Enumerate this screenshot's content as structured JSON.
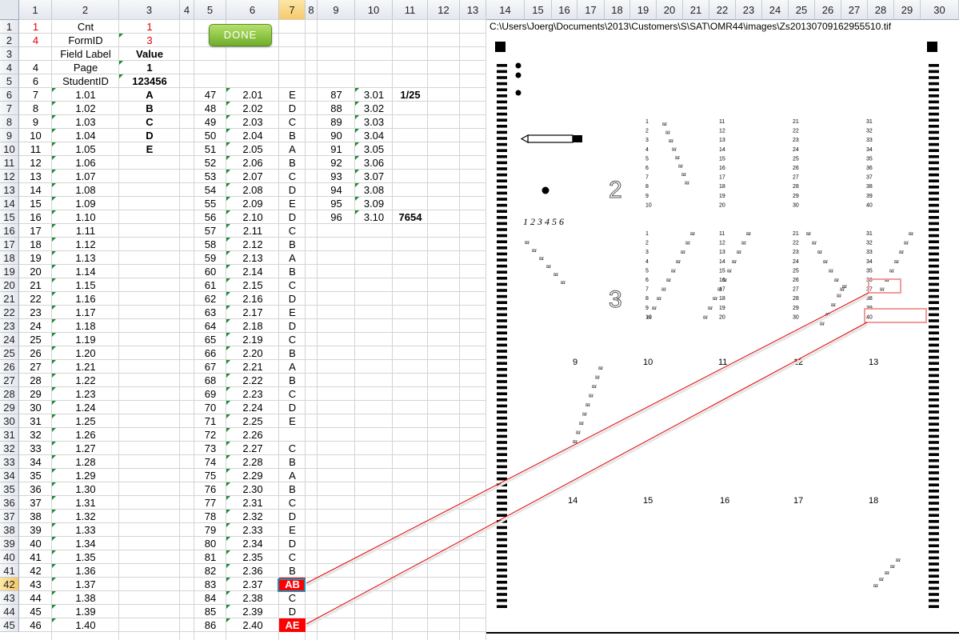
{
  "colors": {
    "red": "#e00000",
    "fill_red": "#ff0000",
    "done_green": "#7fbb35",
    "active_border": "#1e8fb7"
  },
  "columns": [
    "1",
    "2",
    "3",
    "4",
    "5",
    "6",
    "7",
    "8",
    "9",
    "10",
    "11",
    "12",
    "13",
    "14",
    "15",
    "16",
    "17",
    "18",
    "19",
    "20",
    "21",
    "22",
    "23",
    "24",
    "25",
    "26",
    "27",
    "28",
    "29",
    "30"
  ],
  "rows": [
    "1",
    "2",
    "3",
    "4",
    "5",
    "6",
    "7",
    "8",
    "9",
    "10",
    "11",
    "12",
    "13",
    "14",
    "15",
    "16",
    "17",
    "18",
    "19",
    "20",
    "21",
    "22",
    "23",
    "24",
    "25",
    "26",
    "27",
    "28",
    "29",
    "30",
    "31",
    "32",
    "33",
    "34",
    "35",
    "36",
    "37",
    "38",
    "39",
    "40",
    "41",
    "42",
    "43",
    "44",
    "45"
  ],
  "header": {
    "cnt_label": "Cnt",
    "cnt_num": "1",
    "cnt_value": "1",
    "formid_label": "FormID",
    "formid_num": "4",
    "formid_value": "3",
    "field_label": "Field Label",
    "value_label": "Value",
    "page_num": "4",
    "page_label": "Page",
    "page_value": "1",
    "studentid_num": "6",
    "studentid_label": "StudentID",
    "studentid_value": "123456",
    "done_label": "DONE"
  },
  "block1": [
    {
      "n": "7",
      "f": "1.01",
      "v": "A"
    },
    {
      "n": "8",
      "f": "1.02",
      "v": "B"
    },
    {
      "n": "9",
      "f": "1.03",
      "v": "C"
    },
    {
      "n": "10",
      "f": "1.04",
      "v": "D"
    },
    {
      "n": "11",
      "f": "1.05",
      "v": "E"
    },
    {
      "n": "12",
      "f": "1.06",
      "v": ""
    },
    {
      "n": "13",
      "f": "1.07",
      "v": ""
    },
    {
      "n": "14",
      "f": "1.08",
      "v": ""
    },
    {
      "n": "15",
      "f": "1.09",
      "v": ""
    },
    {
      "n": "16",
      "f": "1.10",
      "v": ""
    },
    {
      "n": "17",
      "f": "1.11",
      "v": ""
    },
    {
      "n": "18",
      "f": "1.12",
      "v": ""
    },
    {
      "n": "19",
      "f": "1.13",
      "v": ""
    },
    {
      "n": "20",
      "f": "1.14",
      "v": ""
    },
    {
      "n": "21",
      "f": "1.15",
      "v": ""
    },
    {
      "n": "22",
      "f": "1.16",
      "v": ""
    },
    {
      "n": "23",
      "f": "1.17",
      "v": ""
    },
    {
      "n": "24",
      "f": "1.18",
      "v": ""
    },
    {
      "n": "25",
      "f": "1.19",
      "v": ""
    },
    {
      "n": "26",
      "f": "1.20",
      "v": ""
    },
    {
      "n": "27",
      "f": "1.21",
      "v": ""
    },
    {
      "n": "28",
      "f": "1.22",
      "v": ""
    },
    {
      "n": "29",
      "f": "1.23",
      "v": ""
    },
    {
      "n": "30",
      "f": "1.24",
      "v": ""
    },
    {
      "n": "31",
      "f": "1.25",
      "v": ""
    },
    {
      "n": "32",
      "f": "1.26",
      "v": ""
    },
    {
      "n": "33",
      "f": "1.27",
      "v": ""
    },
    {
      "n": "34",
      "f": "1.28",
      "v": ""
    },
    {
      "n": "35",
      "f": "1.29",
      "v": ""
    },
    {
      "n": "36",
      "f": "1.30",
      "v": ""
    },
    {
      "n": "37",
      "f": "1.31",
      "v": ""
    },
    {
      "n": "38",
      "f": "1.32",
      "v": ""
    },
    {
      "n": "39",
      "f": "1.33",
      "v": ""
    },
    {
      "n": "40",
      "f": "1.34",
      "v": ""
    },
    {
      "n": "41",
      "f": "1.35",
      "v": ""
    },
    {
      "n": "42",
      "f": "1.36",
      "v": ""
    },
    {
      "n": "43",
      "f": "1.37",
      "v": ""
    },
    {
      "n": "44",
      "f": "1.38",
      "v": ""
    },
    {
      "n": "45",
      "f": "1.39",
      "v": ""
    },
    {
      "n": "46",
      "f": "1.40",
      "v": ""
    }
  ],
  "block2": [
    {
      "n": "47",
      "f": "2.01",
      "v": "E"
    },
    {
      "n": "48",
      "f": "2.02",
      "v": "D"
    },
    {
      "n": "49",
      "f": "2.03",
      "v": "C"
    },
    {
      "n": "50",
      "f": "2.04",
      "v": "B"
    },
    {
      "n": "51",
      "f": "2.05",
      "v": "A"
    },
    {
      "n": "52",
      "f": "2.06",
      "v": "B"
    },
    {
      "n": "53",
      "f": "2.07",
      "v": "C"
    },
    {
      "n": "54",
      "f": "2.08",
      "v": "D"
    },
    {
      "n": "55",
      "f": "2.09",
      "v": "E"
    },
    {
      "n": "56",
      "f": "2.10",
      "v": "D"
    },
    {
      "n": "57",
      "f": "2.11",
      "v": "C"
    },
    {
      "n": "58",
      "f": "2.12",
      "v": "B"
    },
    {
      "n": "59",
      "f": "2.13",
      "v": "A"
    },
    {
      "n": "60",
      "f": "2.14",
      "v": "B"
    },
    {
      "n": "61",
      "f": "2.15",
      "v": "C"
    },
    {
      "n": "62",
      "f": "2.16",
      "v": "D"
    },
    {
      "n": "63",
      "f": "2.17",
      "v": "E"
    },
    {
      "n": "64",
      "f": "2.18",
      "v": "D"
    },
    {
      "n": "65",
      "f": "2.19",
      "v": "C"
    },
    {
      "n": "66",
      "f": "2.20",
      "v": "B"
    },
    {
      "n": "67",
      "f": "2.21",
      "v": "A"
    },
    {
      "n": "68",
      "f": "2.22",
      "v": "B"
    },
    {
      "n": "69",
      "f": "2.23",
      "v": "C"
    },
    {
      "n": "70",
      "f": "2.24",
      "v": "D"
    },
    {
      "n": "71",
      "f": "2.25",
      "v": "E"
    },
    {
      "n": "72",
      "f": "2.26",
      "v": ""
    },
    {
      "n": "73",
      "f": "2.27",
      "v": "C"
    },
    {
      "n": "74",
      "f": "2.28",
      "v": "B"
    },
    {
      "n": "75",
      "f": "2.29",
      "v": "A"
    },
    {
      "n": "76",
      "f": "2.30",
      "v": "B"
    },
    {
      "n": "77",
      "f": "2.31",
      "v": "C"
    },
    {
      "n": "78",
      "f": "2.32",
      "v": "D"
    },
    {
      "n": "79",
      "f": "2.33",
      "v": "E"
    },
    {
      "n": "80",
      "f": "2.34",
      "v": "D"
    },
    {
      "n": "81",
      "f": "2.35",
      "v": "C"
    },
    {
      "n": "82",
      "f": "2.36",
      "v": "B"
    },
    {
      "n": "83",
      "f": "2.37",
      "v": "AB"
    },
    {
      "n": "84",
      "f": "2.38",
      "v": "C"
    },
    {
      "n": "85",
      "f": "2.39",
      "v": "D"
    },
    {
      "n": "86",
      "f": "2.40",
      "v": "AE"
    }
  ],
  "block3": [
    {
      "n": "87",
      "f": "3.01",
      "x": "1/25"
    },
    {
      "n": "88",
      "f": "3.02",
      "x": ""
    },
    {
      "n": "89",
      "f": "3.03",
      "x": ""
    },
    {
      "n": "90",
      "f": "3.04",
      "x": ""
    },
    {
      "n": "91",
      "f": "3.05",
      "x": ""
    },
    {
      "n": "92",
      "f": "3.06",
      "x": ""
    },
    {
      "n": "93",
      "f": "3.07",
      "x": ""
    },
    {
      "n": "94",
      "f": "3.08",
      "x": ""
    },
    {
      "n": "95",
      "f": "3.09",
      "x": ""
    },
    {
      "n": "96",
      "f": "3.10",
      "x": "7654"
    }
  ],
  "image": {
    "path": "C:\\Users\\Joerg\\Documents\\2013\\Customers\\S\\SAT\\OMR44\\images\\Zs20130709162955510.tif",
    "section2": "2",
    "section3": "3",
    "handwritten": "1 2 3 4 5 6",
    "col_headers_top": [
      "9",
      "10",
      "11",
      "12",
      "13"
    ],
    "col_headers_bottom": [
      "14",
      "15",
      "16",
      "17",
      "18"
    ],
    "sec2_cols": [
      [
        "1",
        "2",
        "3",
        "4",
        "5",
        "6",
        "7",
        "8",
        "9",
        "10"
      ],
      [
        "11",
        "12",
        "13",
        "14",
        "15",
        "16",
        "17",
        "18",
        "19",
        "20"
      ],
      [
        "21",
        "22",
        "23",
        "24",
        "25",
        "26",
        "27",
        "28",
        "29",
        "30"
      ],
      [
        "31",
        "32",
        "33",
        "34",
        "35",
        "36",
        "37",
        "38",
        "39",
        "40"
      ]
    ],
    "sec3_cols": [
      [
        "1",
        "2",
        "3",
        "4",
        "5",
        "6",
        "7",
        "8",
        "9",
        "10"
      ],
      [
        "11",
        "12",
        "13",
        "14",
        "15",
        "16",
        "17",
        "18",
        "19",
        "20"
      ],
      [
        "21",
        "22",
        "23",
        "24",
        "25",
        "26",
        "27",
        "28",
        "29",
        "30"
      ],
      [
        "31",
        "32",
        "33",
        "34",
        "35",
        "36",
        "37",
        "38",
        "39",
        "40"
      ]
    ]
  }
}
